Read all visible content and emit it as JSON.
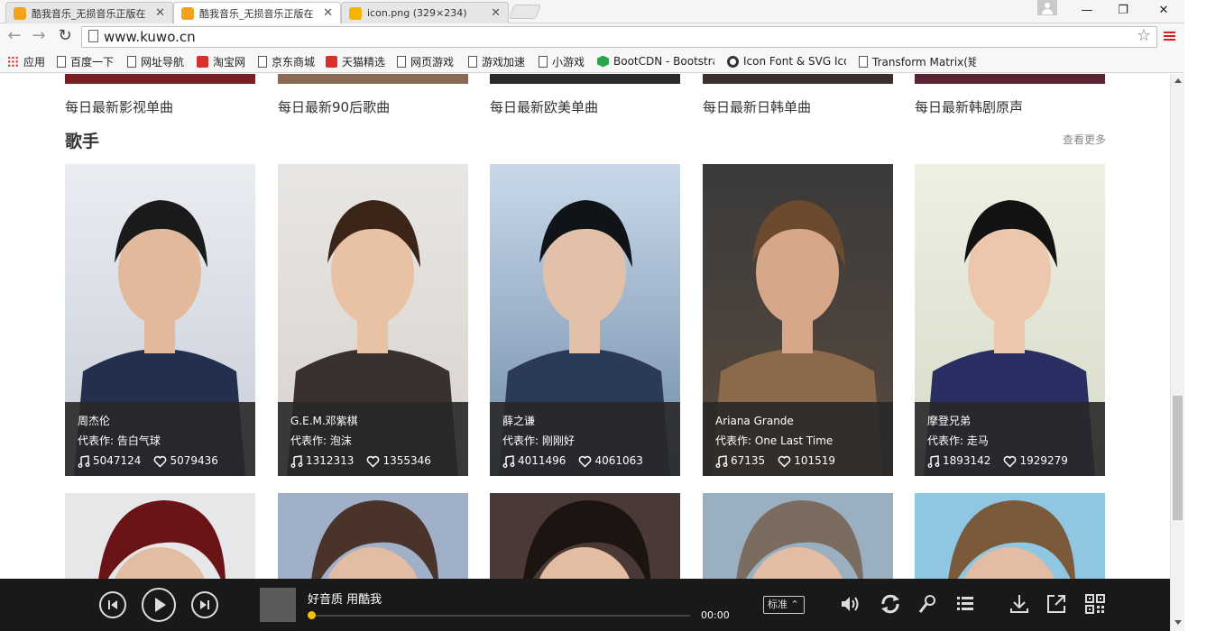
{
  "browser": {
    "tabs": [
      {
        "title": "酷我音乐_无损音乐正版在",
        "active": false
      },
      {
        "title": "酷我音乐_无损音乐正版在",
        "active": true
      },
      {
        "title": "icon.png (329×234)",
        "active": false
      }
    ],
    "url": "www.kuwo.cn",
    "bookmarks": [
      {
        "label": "应用",
        "icon": "apps-grid-icon"
      },
      {
        "label": "百度一下",
        "icon": "page-icon"
      },
      {
        "label": "网址导航",
        "icon": "page-icon"
      },
      {
        "label": "淘宝网",
        "icon": "taobao-icon"
      },
      {
        "label": "京东商城",
        "icon": "page-icon"
      },
      {
        "label": "天猫精选",
        "icon": "tmall-icon"
      },
      {
        "label": "网页游戏",
        "icon": "page-icon"
      },
      {
        "label": "游戏加速",
        "icon": "page-icon"
      },
      {
        "label": "小游戏",
        "icon": "page-icon"
      },
      {
        "label": "BootCDN - Bootstra",
        "icon": "bootcdn-icon"
      },
      {
        "label": "Icon Font & SVG Ico",
        "icon": "iconfont-icon"
      },
      {
        "label": "Transform Matrix(矩",
        "icon": "page-icon"
      }
    ]
  },
  "playlists": [
    {
      "name": "每日最新影视单曲",
      "color": "#7a1f25"
    },
    {
      "name": "每日最新90后歌曲",
      "color": "#8a6a55"
    },
    {
      "name": "每日最新欧美单曲",
      "color": "#2a2a2a"
    },
    {
      "name": "每日最新日韩单曲",
      "color": "#3a3030"
    },
    {
      "name": "每日最新韩剧原声",
      "color": "#5a2433"
    }
  ],
  "section": {
    "title": "歌手",
    "more": "查看更多"
  },
  "singers": [
    {
      "name": "周杰伦",
      "rep_label": "代表作:",
      "rep": "告白气球",
      "plays": "5047124",
      "likes": "5079436",
      "bg_top": "#eaedf2",
      "bg_bottom": "#c8ccd6",
      "figure": "#22304e",
      "skin": "#e2b99a",
      "hair": "#1a1a1a"
    },
    {
      "name": "G.E.M.邓紫棋",
      "rep_label": "代表作:",
      "rep": "泡沫",
      "plays": "1312313",
      "likes": "1355346",
      "bg_top": "#e8e6e4",
      "bg_bottom": "#d8d2cc",
      "figure": "#3a3030",
      "skin": "#e9c2a6",
      "hair": "#3b2418"
    },
    {
      "name": "薛之谦",
      "rep_label": "代表作:",
      "rep": "刚刚好",
      "plays": "4011496",
      "likes": "4061063",
      "bg_top": "#c9d9ea",
      "bg_bottom": "#6f8aa8",
      "figure": "#2b3a55",
      "skin": "#e3c0a8",
      "hair": "#101318"
    },
    {
      "name": "Ariana Grande",
      "rep_label": "代表作:",
      "rep": "One Last Time",
      "plays": "67135",
      "likes": "101519",
      "bg_top": "#3a3a3a",
      "bg_bottom": "#5a4a3e",
      "figure": "#8a6a4a",
      "skin": "#d7a78a",
      "hair": "#6b4a2e"
    },
    {
      "name": "摩登兄弟",
      "rep_label": "代表作:",
      "rep": "走马",
      "plays": "1893142",
      "likes": "1929279",
      "bg_top": "#eef0e2",
      "bg_bottom": "#d6dac8",
      "figure": "#2a2f63",
      "skin": "#ecc7ad",
      "hair": "#121212"
    }
  ],
  "row2": [
    {
      "bg": "#e7e7ea",
      "hair": "#6b1418"
    },
    {
      "bg": "#9fb0c8",
      "hair": "#4a3328"
    },
    {
      "bg": "#4a3a36",
      "hair": "#1c1410"
    },
    {
      "bg": "#9ab0c0",
      "hair": "#7a6c5e"
    },
    {
      "bg": "#8fc7e3",
      "hair": "#7a5a3a"
    }
  ],
  "player": {
    "title": "好音质 用酷我",
    "time": "00:00",
    "quality": "标准",
    "progress": 0,
    "accent": "#f6c300"
  }
}
